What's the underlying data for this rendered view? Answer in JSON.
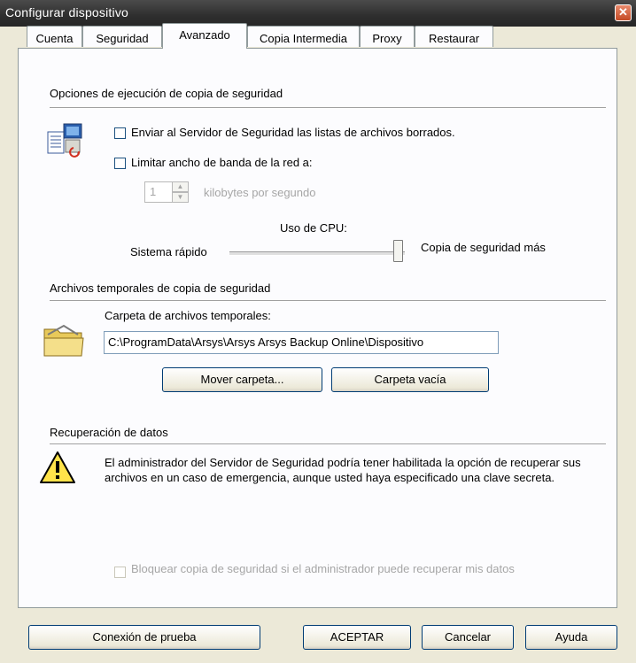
{
  "window": {
    "title": "Configurar dispositivo"
  },
  "tabs": [
    {
      "label": "Cuenta"
    },
    {
      "label": "Seguridad"
    },
    {
      "label": "Avanzado"
    },
    {
      "label": "Copia Intermedia"
    },
    {
      "label": "Proxy"
    },
    {
      "label": "Restaurar"
    }
  ],
  "active_tab": "Avanzado",
  "backup_options": {
    "heading": "Opciones de ejecución de copia de seguridad",
    "send_deleted_lists": {
      "label": "Enviar al Servidor de Seguridad las listas de archivos borrados.",
      "checked": false
    },
    "limit_bandwidth": {
      "label": "Limitar ancho de banda de la red a:",
      "checked": false
    },
    "bandwidth_value": "1",
    "bandwidth_unit": "kilobytes por segundo",
    "cpu_label": "Uso de CPU:",
    "cpu_left_label": "Sistema rápido",
    "cpu_right_label": "Copia de seguridad más",
    "cpu_level_fraction": 1.0
  },
  "temp_files": {
    "heading": "Archivos temporales de copia de seguridad",
    "folder_label": "Carpeta de archivos temporales:",
    "folder_path": "C:\\ProgramData\\Arsys\\Arsys Arsys Backup Online\\Dispositivo",
    "move_button": "Mover carpeta...",
    "empty_button": "Carpeta vacía"
  },
  "recovery": {
    "heading": "Recuperación de datos",
    "text": "El administrador del Servidor de Seguridad podría tener habilitada la opción de recuperar sus archivos en un caso de emergencia, aunque usted haya especificado una clave secreta.",
    "block_label": "Bloquear copia de seguridad si el administrador puede recuperar mis datos",
    "block_checked": false
  },
  "footer": {
    "test_button": "Conexión de prueba",
    "ok_button": "ACEPTAR",
    "cancel_button": "Cancelar",
    "help_button": "Ayuda"
  },
  "colors": {
    "titlebar": "#2e2e2e",
    "close": "#c44a25",
    "dialog": "#ece9d8",
    "panel": "#fcfcfe"
  }
}
